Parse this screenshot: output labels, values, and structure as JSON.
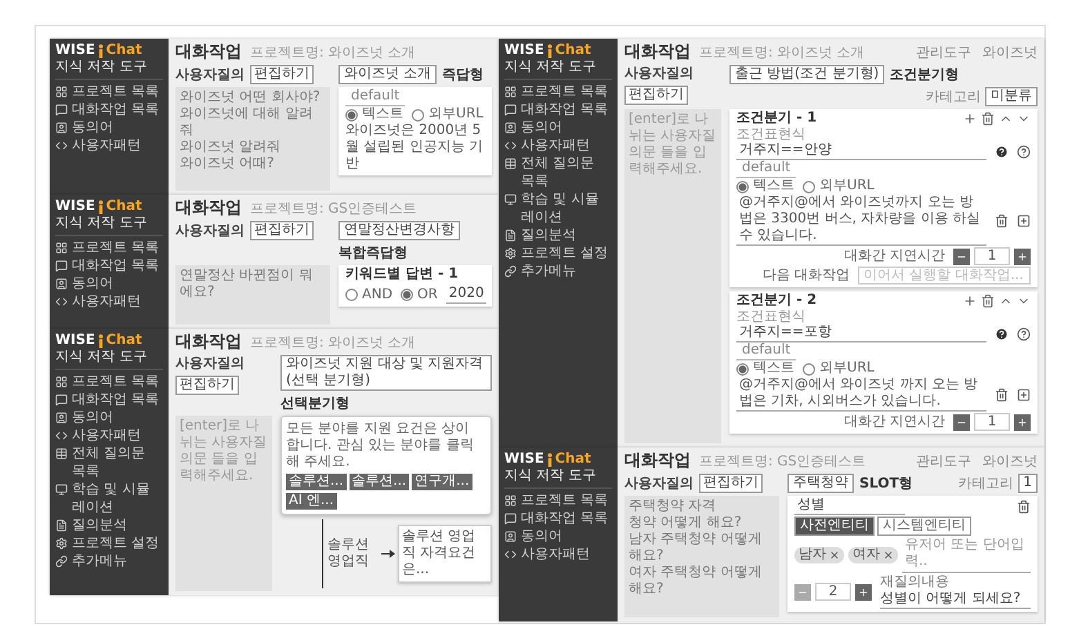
{
  "windows": [
    {
      "kind": "text",
      "logo": {
        "brand": "WISE",
        "product": "Chat"
      },
      "subtitle": "지식 저작 도구",
      "nav": [
        "프로젝트 목록",
        "대화작업 목록",
        "동의어",
        "사용자패턴"
      ],
      "title": "대화작업",
      "project": "프로젝트명: 와이즈넛 소개",
      "question_label": "사용자질의",
      "edit_button": "편집하기",
      "name": "와이즈넛 소개",
      "type": "즉답형",
      "questions": [
        "와이즈넛 어떤 회사야?",
        "와이즈넛에 대해 알려줘",
        "와이즈넛 알려줘",
        "와이즈넛 어때?"
      ],
      "answer": {
        "tab": "default",
        "modes": [
          {
            "label": "텍스트",
            "selected": true
          },
          {
            "label": "외부URL",
            "selected": false
          }
        ],
        "text": "와이즈넛은 2000년 5월 설립된 인공지능 기반"
      }
    },
    {
      "kind": "keyword",
      "logo": {
        "brand": "WISE",
        "product": "Chat"
      },
      "subtitle": "지식 저작 도구",
      "nav": [
        "프로젝트 목록",
        "대화작업 목록",
        "동의어",
        "사용자패턴"
      ],
      "title": "대화작업",
      "project": "프로젝트명: GS인증테스트",
      "question_label": "사용자질의",
      "edit_button": "편집하기",
      "name": "연말정산변경사항",
      "type": "복합즉답형",
      "questions": [
        "연말정산 바뀐점이 뭐에요?"
      ],
      "keyword": {
        "title": "키워드별 답변 - 1",
        "operators": [
          {
            "label": "AND",
            "selected": false
          },
          {
            "label": "OR",
            "selected": true
          }
        ],
        "value": "2020"
      }
    },
    {
      "kind": "tree",
      "logo": {
        "brand": "WISE",
        "product": "Chat"
      },
      "subtitle": "지식 저작 도구",
      "nav": [
        "프로젝트 목록",
        "대화작업 목록",
        "동의어",
        "사용자패턴",
        "전체 질의문 목록",
        "학습 및 시뮬레이션",
        "질의분석",
        "프로젝트 설정",
        "추가메뉴"
      ],
      "title": "대화작업",
      "project": "프로젝트명: 와이즈넛 소개",
      "question_label": "사용자질의",
      "edit_button": "편집하기",
      "name": "와이즈넛 지원 대상 및 지원자격 (선택 분기형)",
      "type": "선택분기형",
      "question_placeholder": "[enter]로 나뉘는 사용자질의문 들을 입력해주세요.",
      "tree": {
        "prompt": "모든 분야를 지원 요건은 상이 합니다. 관심 있는 분야를 클릭 해 주세요.",
        "options": [
          "솔루션...",
          "솔루션...",
          "연구개...",
          "AI 엔..."
        ],
        "branches": [
          {
            "label": "솔루션 영업직",
            "text": "솔루션 영업직 자격요건은..."
          }
        ]
      }
    },
    {
      "kind": "condition",
      "logo": {
        "brand": "WISE",
        "product": "Chat"
      },
      "subtitle": "지식 저작 도구",
      "nav": [
        "프로젝트 목록",
        "대화작업 목록",
        "동의어",
        "사용자패턴",
        "전체 질의문 목록",
        "학습 및 시뮬레이션",
        "질의분석",
        "프로젝트 설정",
        "추가메뉴"
      ],
      "title": "대화작업",
      "project": "프로젝트명: 와이즈넛 소개",
      "header_links": [
        "관리도구",
        "와이즈넛"
      ],
      "question_label": "사용자질의",
      "edit_button": "편집하기",
      "name": "출근 방법(조건 분기형)",
      "type": "조건분기형",
      "category": {
        "label": "카테고리",
        "value": "미분류"
      },
      "question_placeholder": "[enter]로 나뉘는 사용자질의문 들을 입력해주세요.",
      "conditions": [
        {
          "title": "조건분기 - 1",
          "expression_label": "조건표현식",
          "expression": "거주지==안양",
          "tab": "default",
          "modes": [
            {
              "label": "텍스트",
              "selected": true
            },
            {
              "label": "외부URL",
              "selected": false
            }
          ],
          "answer": "@거주지@에서 와이즈넛까지 오는 방법은 3300번 버스, 자차량을 이용 하실 수 있습니다.",
          "delay_label": "대화간 지연시간",
          "delay": "1",
          "next_label": "다음 대화작업",
          "next_placeholder": "이어서 실행할 대화작업..."
        },
        {
          "title": "조건분기 - 2",
          "expression_label": "조건표현식",
          "expression": "거주지==포항",
          "tab": "default",
          "modes": [
            {
              "label": "텍스트",
              "selected": true
            },
            {
              "label": "외부URL",
              "selected": false
            }
          ],
          "answer": "@거주지@에서 와이즈넛 까지 오는 방법은 기차, 시외버스가 있습니다.",
          "delay_label": "대화간 지연시간",
          "delay": "1"
        }
      ]
    },
    {
      "kind": "slot",
      "logo": {
        "brand": "WISE",
        "product": "Chat"
      },
      "subtitle": "지식 저작 도구",
      "nav": [
        "프로젝트 목록",
        "대화작업 목록",
        "동의어",
        "사용자패턴"
      ],
      "title": "대화작업",
      "project": "프로젝트명: GS인증테스트",
      "header_links": [
        "관리도구",
        "와이즈넛"
      ],
      "question_label": "사용자질의",
      "edit_button": "편집하기",
      "name": "주택청약",
      "type": "SLOT형",
      "category": {
        "label": "카테고리",
        "value": "1"
      },
      "questions": [
        "주택청약 자격",
        "청약 어떻게 해요?",
        "남자 주택청약 어떻게해요?",
        "여자 주택청약 어떻게해요?"
      ],
      "slot": {
        "name": "성별",
        "entity_types": [
          {
            "label": "사전엔티티",
            "selected": true
          },
          {
            "label": "시스템엔티티",
            "selected": false
          }
        ],
        "values": [
          "남자",
          "여자"
        ],
        "value_placeholder": "유저어 또는 단어입력..",
        "count": "2",
        "reprompt_label": "재질의내용",
        "reprompt": "성별이 어떻게 되세요?"
      }
    }
  ]
}
